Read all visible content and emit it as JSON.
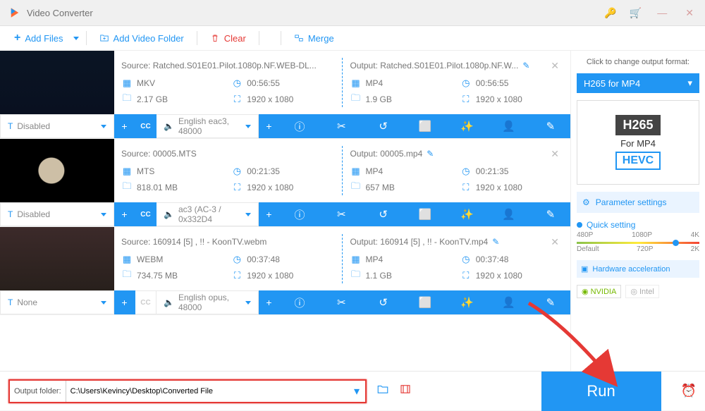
{
  "app": {
    "title": "Video Converter"
  },
  "toolbar": {
    "add_files": "Add Files",
    "add_folder": "Add Video Folder",
    "clear": "Clear",
    "merge": "Merge"
  },
  "items": [
    {
      "source_label": "Source: Ratched.S01E01.Pilot.1080p.NF.WEB-DL...",
      "output_label": "Output: Ratched.S01E01.Pilot.1080p.NF.W...",
      "src_fmt": "MKV",
      "src_dur": "00:56:55",
      "src_size": "2.17 GB",
      "src_res": "1920 x 1080",
      "out_fmt": "MP4",
      "out_dur": "00:56:55",
      "out_size": "1.9 GB",
      "out_res": "1920 x 1080",
      "subtitle": "Disabled",
      "audio": "English eac3, 48000",
      "cc_on": true
    },
    {
      "source_label": "Source: 00005.MTS",
      "output_label": "Output: 00005.mp4",
      "src_fmt": "MTS",
      "src_dur": "00:21:35",
      "src_size": "818.01 MB",
      "src_res": "1920 x 1080",
      "out_fmt": "MP4",
      "out_dur": "00:21:35",
      "out_size": "657 MB",
      "out_res": "1920 x 1080",
      "subtitle": "Disabled",
      "audio": "ac3 (AC-3 / 0x332D4",
      "cc_on": true
    },
    {
      "source_label": "Source: 160914 [5] , !! - KoonTV.webm",
      "output_label": "Output: 160914 [5] , !! - KoonTV.mp4",
      "src_fmt": "WEBM",
      "src_dur": "00:37:48",
      "src_size": "734.75 MB",
      "src_res": "1920 x 1080",
      "out_fmt": "MP4",
      "out_dur": "00:37:48",
      "out_size": "1.1 GB",
      "out_res": "1920 x 1080",
      "subtitle": "None",
      "audio": "English opus, 48000",
      "cc_on": false
    }
  ],
  "side": {
    "title": "Click to change output format:",
    "format_name": "H265 for MP4",
    "h265": "H265",
    "formp4": "For MP4",
    "hevc": "HEVC",
    "param": "Parameter settings",
    "quick": "Quick setting",
    "q": {
      "p480": "480P",
      "p1080": "1080P",
      "p4k": "4K",
      "def": "Default",
      "p720": "720P",
      "p2k": "2K"
    },
    "hw": "Hardware acceleration",
    "nvidia": "NVIDIA",
    "intel": "Intel"
  },
  "footer": {
    "label": "Output folder:",
    "path": "C:\\Users\\Kevincy\\Desktop\\Converted File",
    "run": "Run"
  }
}
